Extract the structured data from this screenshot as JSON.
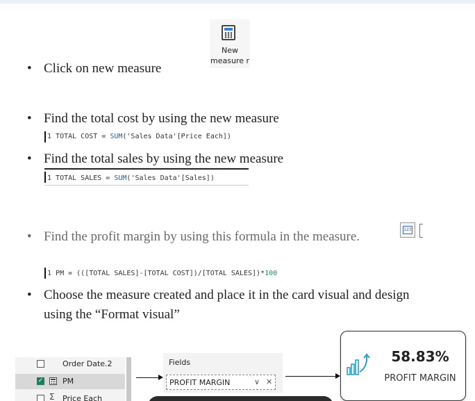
{
  "new_measure_button": {
    "line1": "New",
    "line2": "measure r"
  },
  "bullets": [
    "Click on new measure",
    "Find the total cost by using the new measure",
    "Find the total sales by using the new measure",
    "Find the profit margin by using this formula in the measure.",
    "Choose the measure created and place it in the card visual and design",
    "using the “Format visual”"
  ],
  "code": {
    "total_cost": {
      "line_no": "1",
      "pre": " TOTAL COST = ",
      "fn": "SUM",
      "args": "('Sales Data'[Price Each])"
    },
    "total_sales": {
      "line_no": "1",
      "pre": " TOTAL SALES = ",
      "fn": "SUM",
      "args": "('Sales Data'[Sales])"
    },
    "pm": {
      "line_no": "1",
      "pre": " PM = (([TOTAL SALES]-[TOTAL COST])/[TOTAL SALES])*",
      "num": "100"
    }
  },
  "measure_icon_text": "123",
  "fields_list": {
    "items": [
      {
        "label": "Order Date.2",
        "checked": false
      },
      {
        "label": "PM",
        "checked": true
      },
      {
        "label": "Price Each",
        "checked": false
      }
    ]
  },
  "fields_well": {
    "heading": "Fields",
    "value": "PROFIT MARGIN",
    "chevron": "∨",
    "close": "✕"
  },
  "card_visual": {
    "value": "58.83%",
    "label": "PROFIT MARGIN"
  },
  "colors": {
    "accent_blue": "#3a7bd5",
    "check_green": "#1e7f5c",
    "card_icon": "#2aa0c8",
    "text_gray": "#6a6a6a"
  }
}
